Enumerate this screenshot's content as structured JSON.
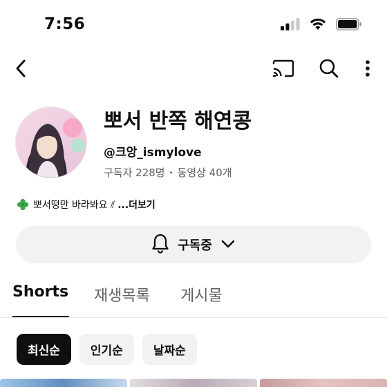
{
  "status_bar": {
    "time": "7:56",
    "icons": [
      "signal-icon",
      "wifi-icon",
      "battery-icon"
    ]
  },
  "top_bar": {
    "icons": [
      "back-arrow-icon",
      "cast-icon",
      "search-icon",
      "more-vert-icon"
    ]
  },
  "channel": {
    "name": "뽀서 반쪽 해연콩",
    "handle": "@크앙_ismylove",
    "subscribers": "구독자 228명",
    "separator": "•",
    "videos": "동영상 40개",
    "description": "뽀서떵만 바라봐요 ⫽",
    "description_more": "...더보기"
  },
  "subscribe": {
    "label": "구독중"
  },
  "tabs": [
    {
      "label": "Shorts",
      "active": true
    },
    {
      "label": "재생목록",
      "active": false
    },
    {
      "label": "게시물",
      "active": false
    }
  ],
  "chips": [
    {
      "label": "최신순",
      "active": true
    },
    {
      "label": "인기순",
      "active": false
    },
    {
      "label": "날짜순",
      "active": false
    }
  ],
  "colors": {
    "text_primary": "#0f0f0f",
    "text_secondary": "#606060",
    "chip_bg": "#f2f2f2",
    "chip_active_bg": "#0f0f0f"
  }
}
